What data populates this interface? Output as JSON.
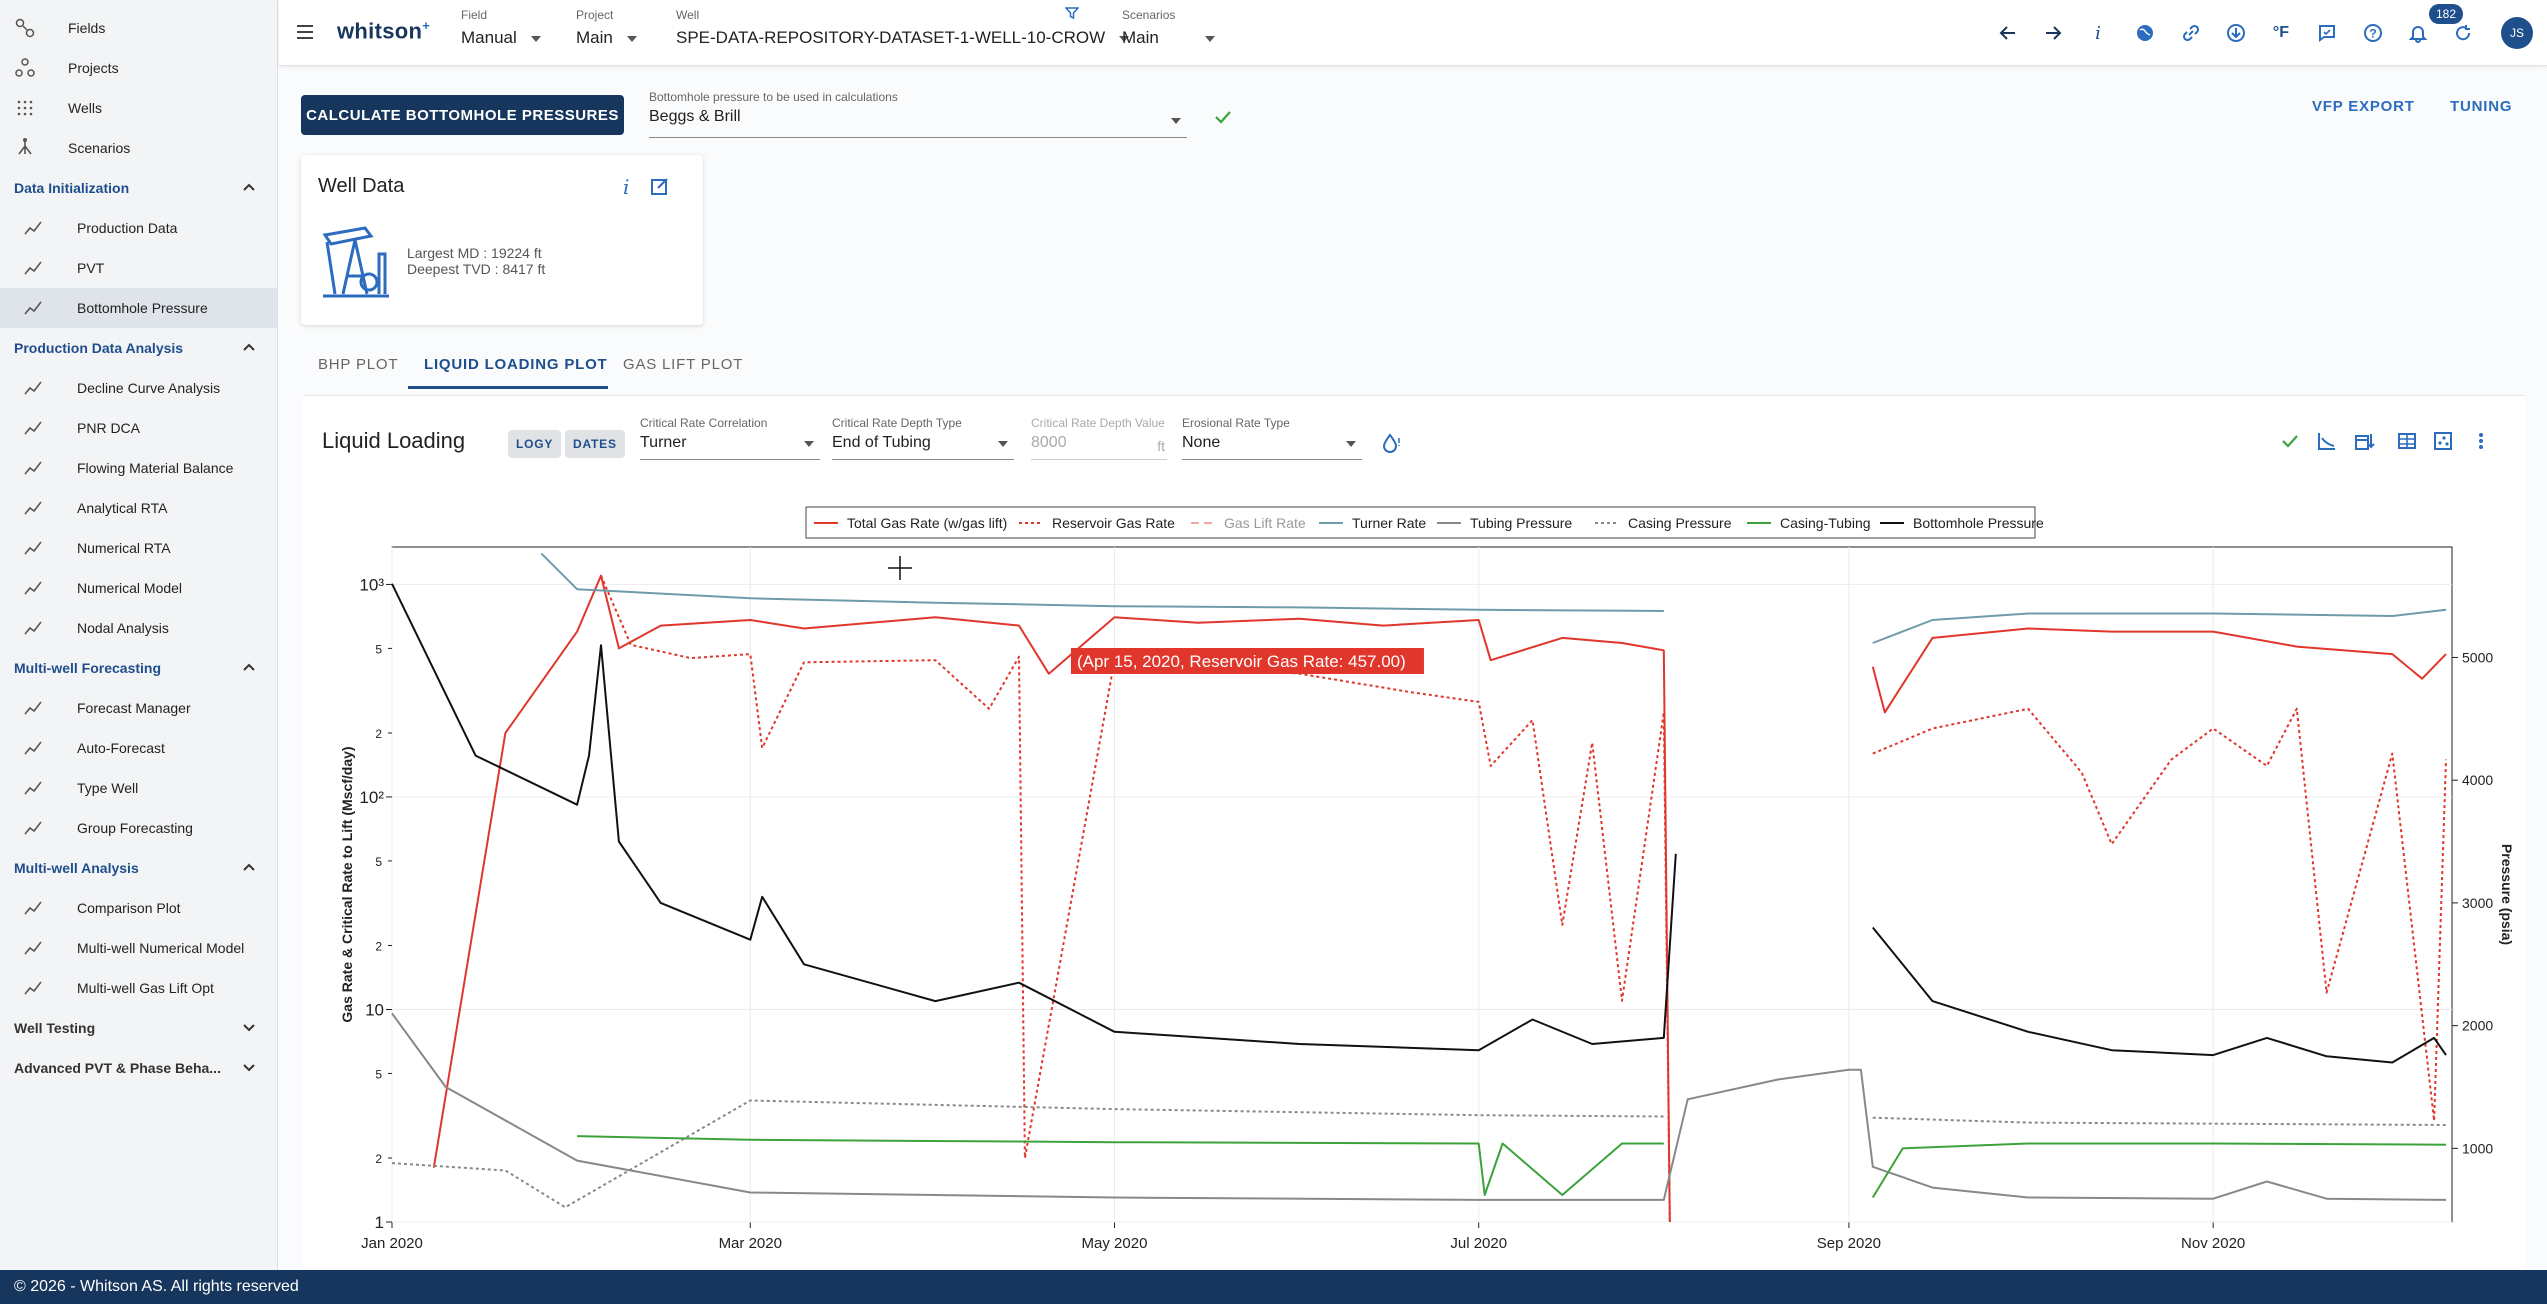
{
  "sidebar": {
    "top_items": [
      {
        "label": "Fields",
        "icon": "fields-icon"
      },
      {
        "label": "Projects",
        "icon": "projects-icon"
      },
      {
        "label": "Wells",
        "icon": "wells-icon"
      },
      {
        "label": "Scenarios",
        "icon": "scenarios-icon"
      }
    ],
    "sections": [
      {
        "title": "Data Initialization",
        "items": [
          "Production Data",
          "PVT",
          "Bottomhole Pressure"
        ]
      },
      {
        "title": "Production Data Analysis",
        "items": [
          "Decline Curve Analysis",
          "PNR DCA",
          "Flowing Material Balance",
          "Analytical RTA",
          "Numerical RTA",
          "Numerical Model",
          "Nodal Analysis"
        ]
      },
      {
        "title": "Multi-well Forecasting",
        "items": [
          "Forecast Manager",
          "Auto-Forecast",
          "Type Well",
          "Group Forecasting"
        ]
      },
      {
        "title": "Multi-well Analysis",
        "items": [
          "Comparison Plot",
          "Multi-well Numerical Model",
          "Multi-well Gas Lift Opt"
        ]
      }
    ],
    "collapsed_sections": [
      "Well Testing",
      "Advanced PVT & Phase Beha..."
    ],
    "active_item": "Bottomhole Pressure"
  },
  "topbar": {
    "logo": "whitson",
    "logo_sup": "+",
    "field_caption": "Field",
    "field_value": "Manual",
    "project_caption": "Project",
    "project_value": "Main",
    "well_caption": "Well",
    "well_value": "SPE-DATA-REPOSITORY-DATASET-1-WELL-10-CROW",
    "scenarios_caption": "Scenarios",
    "scenarios_value": "Main",
    "notification_count": "182",
    "avatar_initials": "JS",
    "unit_label": "°F"
  },
  "main": {
    "calc_button": "CALCULATE BOTTOMHOLE PRESSURES",
    "bhp_select_caption": "Bottomhole pressure to be used in calculations",
    "bhp_select_value": "Beggs & Brill",
    "vfp_export": "VFP EXPORT",
    "tuning": "TUNING",
    "well_card": {
      "title": "Well Data",
      "largest_md": "Largest MD :  19224 ft",
      "deepest_tvd": "Deepest TVD :  8417 ft"
    },
    "tabs": [
      "BHP PLOT",
      "LIQUID LOADING PLOT",
      "GAS LIFT PLOT"
    ],
    "panel": {
      "title": "Liquid Loading",
      "chip_logy": "LOGY",
      "chip_dates": "DATES",
      "crit_corr_caption": "Critical Rate Correlation",
      "crit_corr_value": "Turner",
      "crit_depth_type_caption": "Critical Rate Depth Type",
      "crit_depth_type_value": "End of Tubing",
      "crit_depth_value_caption": "Critical Rate Depth Value",
      "crit_depth_value": "8000",
      "crit_depth_unit": "ft",
      "erosional_caption": "Erosional Rate Type",
      "erosional_value": "None"
    }
  },
  "chart_data": {
    "type": "line",
    "xlabel": "",
    "ylabel": "Gas Rate & Critical Rate to Lift (Mscf/day)",
    "y2label": "Pressure (psia)",
    "yscale": "log",
    "ylim": [
      1,
      1500
    ],
    "y2lim": [
      400,
      5900
    ],
    "xlim": [
      "2020-01-01",
      "2020-12-11"
    ],
    "x_ticks": [
      "Jan 2020",
      "Mar 2020",
      "May 2020",
      "Jul 2020",
      "Sep 2020",
      "Nov 2020"
    ],
    "y_ticks_major": [
      "1",
      "10",
      "10²",
      "10³"
    ],
    "y_ticks_minor": [
      "2",
      "5",
      "2",
      "5",
      "2",
      "5"
    ],
    "y2_ticks": [
      "1000",
      "2000",
      "3000",
      "4000",
      "5000"
    ],
    "legend": [
      "Total Gas Rate (w/gas lift)",
      "Reservoir Gas Rate",
      "Gas Lift Rate",
      "Turner Rate",
      "Tubing Pressure",
      "Casing Pressure",
      "Casing-Tubing",
      "Bottomhole Pressure"
    ],
    "tooltip": "(Apr 15, 2020, Reservoir Gas Rate: 457.00)",
    "series": [
      {
        "name": "Total Gas Rate (w/gas lift)",
        "color": "#e0362c",
        "dash": "solid",
        "axis": "y",
        "points": [
          [
            "2020-01-08",
            1.8
          ],
          [
            "2020-01-20",
            200
          ],
          [
            "2020-02-01",
            600
          ],
          [
            "2020-02-05",
            1100
          ],
          [
            "2020-02-08",
            500
          ],
          [
            "2020-02-15",
            640
          ],
          [
            "2020-03-01",
            680
          ],
          [
            "2020-03-10",
            620
          ],
          [
            "2020-04-01",
            700
          ],
          [
            "2020-04-15",
            640
          ],
          [
            "2020-04-20",
            380
          ],
          [
            "2020-05-01",
            700
          ],
          [
            "2020-05-15",
            660
          ],
          [
            "2020-06-01",
            690
          ],
          [
            "2020-06-15",
            640
          ],
          [
            "2020-07-01",
            680
          ],
          [
            "2020-07-03",
            440
          ],
          [
            "2020-07-15",
            560
          ],
          [
            "2020-07-25",
            530
          ],
          [
            "2020-08-01",
            490
          ],
          [
            "2020-08-02",
            1
          ],
          [
            "2020-09-01",
            null
          ],
          [
            "2020-09-05",
            410
          ],
          [
            "2020-09-07",
            250
          ],
          [
            "2020-09-15",
            560
          ],
          [
            "2020-10-01",
            620
          ],
          [
            "2020-10-15",
            600
          ],
          [
            "2020-11-01",
            600
          ],
          [
            "2020-11-15",
            510
          ],
          [
            "2020-12-01",
            470
          ],
          [
            "2020-12-06",
            360
          ],
          [
            "2020-12-10",
            470
          ]
        ]
      },
      {
        "name": "Reservoir Gas Rate",
        "color": "#e0362c",
        "dash": "dot",
        "axis": "y",
        "points": [
          [
            "2020-02-05",
            1100
          ],
          [
            "2020-02-10",
            520
          ],
          [
            "2020-02-20",
            450
          ],
          [
            "2020-03-01",
            470
          ],
          [
            "2020-03-03",
            170
          ],
          [
            "2020-03-10",
            430
          ],
          [
            "2020-04-01",
            440
          ],
          [
            "2020-04-10",
            260
          ],
          [
            "2020-04-15",
            457
          ],
          [
            "2020-04-16",
            2
          ],
          [
            "2020-05-01",
            440
          ],
          [
            "2020-06-01",
            380
          ],
          [
            "2020-06-20",
            310
          ],
          [
            "2020-07-01",
            280
          ],
          [
            "2020-07-03",
            140
          ],
          [
            "2020-07-10",
            230
          ],
          [
            "2020-07-15",
            25
          ],
          [
            "2020-07-20",
            180
          ],
          [
            "2020-07-25",
            11
          ],
          [
            "2020-08-01",
            250
          ],
          [
            "2020-08-02",
            1
          ],
          [
            "2020-09-01",
            null
          ],
          [
            "2020-09-05",
            160
          ],
          [
            "2020-09-15",
            210
          ],
          [
            "2020-10-01",
            260
          ],
          [
            "2020-10-10",
            130
          ],
          [
            "2020-10-15",
            60
          ],
          [
            "2020-10-25",
            150
          ],
          [
            "2020-11-01",
            210
          ],
          [
            "2020-11-10",
            140
          ],
          [
            "2020-11-15",
            260
          ],
          [
            "2020-11-20",
            12
          ],
          [
            "2020-12-01",
            160
          ],
          [
            "2020-12-08",
            3
          ],
          [
            "2020-12-10",
            150
          ]
        ]
      },
      {
        "name": "Turner Rate",
        "color": "#6f9ba8",
        "dash": "solid",
        "axis": "y",
        "points": [
          [
            "2020-01-26",
            1400
          ],
          [
            "2020-02-01",
            950
          ],
          [
            "2020-03-01",
            860
          ],
          [
            "2020-04-01",
            820
          ],
          [
            "2020-05-01",
            790
          ],
          [
            "2020-06-01",
            780
          ],
          [
            "2020-07-01",
            760
          ],
          [
            "2020-08-01",
            750
          ],
          [
            "2020-09-01",
            null
          ],
          [
            "2020-09-05",
            530
          ],
          [
            "2020-09-15",
            680
          ],
          [
            "2020-10-01",
            730
          ],
          [
            "2020-11-01",
            730
          ],
          [
            "2020-12-01",
            710
          ],
          [
            "2020-12-10",
            760
          ]
        ]
      },
      {
        "name": "Tubing Pressure",
        "color": "#888888",
        "dash": "solid",
        "axis": "y2",
        "points": [
          [
            "2020-01-01",
            2100
          ],
          [
            "2020-01-10",
            1500
          ],
          [
            "2020-02-01",
            900
          ],
          [
            "2020-03-01",
            640
          ],
          [
            "2020-05-01",
            600
          ],
          [
            "2020-07-01",
            580
          ],
          [
            "2020-08-01",
            580
          ],
          [
            "2020-08-05",
            1400
          ],
          [
            "2020-08-20",
            1560
          ],
          [
            "2020-09-01",
            1640
          ],
          [
            "2020-09-03",
            1640
          ],
          [
            "2020-09-05",
            850
          ],
          [
            "2020-09-15",
            680
          ],
          [
            "2020-10-01",
            600
          ],
          [
            "2020-11-01",
            590
          ],
          [
            "2020-11-10",
            730
          ],
          [
            "2020-11-20",
            590
          ],
          [
            "2020-12-10",
            580
          ]
        ]
      },
      {
        "name": "Casing Pressure",
        "color": "#888888",
        "dash": "dot",
        "axis": "y2",
        "points": [
          [
            "2020-01-01",
            880
          ],
          [
            "2020-01-20",
            820
          ],
          [
            "2020-01-30",
            520
          ],
          [
            "2020-03-01",
            1390
          ],
          [
            "2020-05-01",
            1320
          ],
          [
            "2020-07-01",
            1270
          ],
          [
            "2020-08-01",
            1260
          ],
          [
            "2020-09-01",
            null
          ],
          [
            "2020-09-05",
            1250
          ],
          [
            "2020-10-01",
            1210
          ],
          [
            "2020-12-10",
            1190
          ]
        ]
      },
      {
        "name": "Casing-Tubing",
        "color": "#3ba33a",
        "dash": "solid",
        "axis": "y2",
        "points": [
          [
            "2020-02-01",
            1100
          ],
          [
            "2020-03-01",
            1070
          ],
          [
            "2020-05-01",
            1050
          ],
          [
            "2020-07-01",
            1040
          ],
          [
            "2020-07-02",
            620
          ],
          [
            "2020-07-05",
            1040
          ],
          [
            "2020-07-15",
            620
          ],
          [
            "2020-07-25",
            1040
          ],
          [
            "2020-08-01",
            1040
          ],
          [
            "2020-09-01",
            null
          ],
          [
            "2020-09-05",
            600
          ],
          [
            "2020-09-10",
            1000
          ],
          [
            "2020-10-01",
            1040
          ],
          [
            "2020-11-01",
            1040
          ],
          [
            "2020-12-10",
            1030
          ]
        ]
      },
      {
        "name": "Bottomhole Pressure",
        "color": "#111111",
        "dash": "solid",
        "axis": "y2",
        "points": [
          [
            "2020-01-01",
            5600
          ],
          [
            "2020-01-15",
            4200
          ],
          [
            "2020-02-01",
            3800
          ],
          [
            "2020-02-03",
            4200
          ],
          [
            "2020-02-05",
            5100
          ],
          [
            "2020-02-08",
            3500
          ],
          [
            "2020-02-15",
            3000
          ],
          [
            "2020-03-01",
            2700
          ],
          [
            "2020-03-03",
            3050
          ],
          [
            "2020-03-10",
            2500
          ],
          [
            "2020-04-01",
            2200
          ],
          [
            "2020-04-15",
            2350
          ],
          [
            "2020-05-01",
            1950
          ],
          [
            "2020-06-01",
            1850
          ],
          [
            "2020-07-01",
            1800
          ],
          [
            "2020-07-10",
            2050
          ],
          [
            "2020-07-20",
            1850
          ],
          [
            "2020-08-01",
            1900
          ],
          [
            "2020-08-03",
            3400
          ],
          [
            "2020-09-01",
            null
          ],
          [
            "2020-09-05",
            2800
          ],
          [
            "2020-09-15",
            2200
          ],
          [
            "2020-10-01",
            1950
          ],
          [
            "2020-10-15",
            1800
          ],
          [
            "2020-11-01",
            1760
          ],
          [
            "2020-11-10",
            1900
          ],
          [
            "2020-11-20",
            1750
          ],
          [
            "2020-12-01",
            1700
          ],
          [
            "2020-12-08",
            1900
          ],
          [
            "2020-12-10",
            1760
          ]
        ]
      }
    ]
  }
}
